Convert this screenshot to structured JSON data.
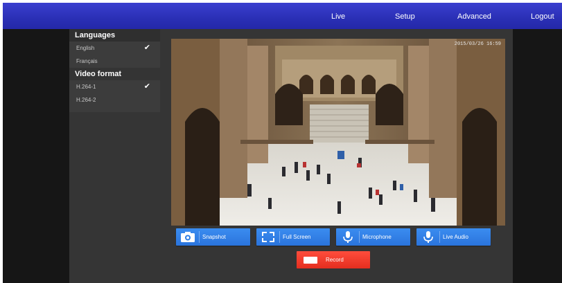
{
  "topnav": {
    "items": [
      {
        "label": "Live"
      },
      {
        "label": "Setup"
      },
      {
        "label": "Advanced"
      },
      {
        "label": "Logout"
      }
    ]
  },
  "sidebar": {
    "languages_title": "Languages",
    "languages": [
      {
        "label": "English",
        "selected": true
      },
      {
        "label": "Français",
        "selected": false
      }
    ],
    "video_format_title": "Video format",
    "video_formats": [
      {
        "label": "H.264-1",
        "selected": true
      },
      {
        "label": "H.264-2",
        "selected": false
      }
    ]
  },
  "video": {
    "timestamp": "2015/03/26 16:59"
  },
  "controls": {
    "snapshot": "Snapshot",
    "full_screen": "Full Screen",
    "microphone": "Microphone",
    "live_audio": "Live Audio",
    "record": "Record"
  },
  "colors": {
    "nav": "#2a2fb5",
    "button": "#2f7fe6",
    "record": "#f03a2a"
  }
}
